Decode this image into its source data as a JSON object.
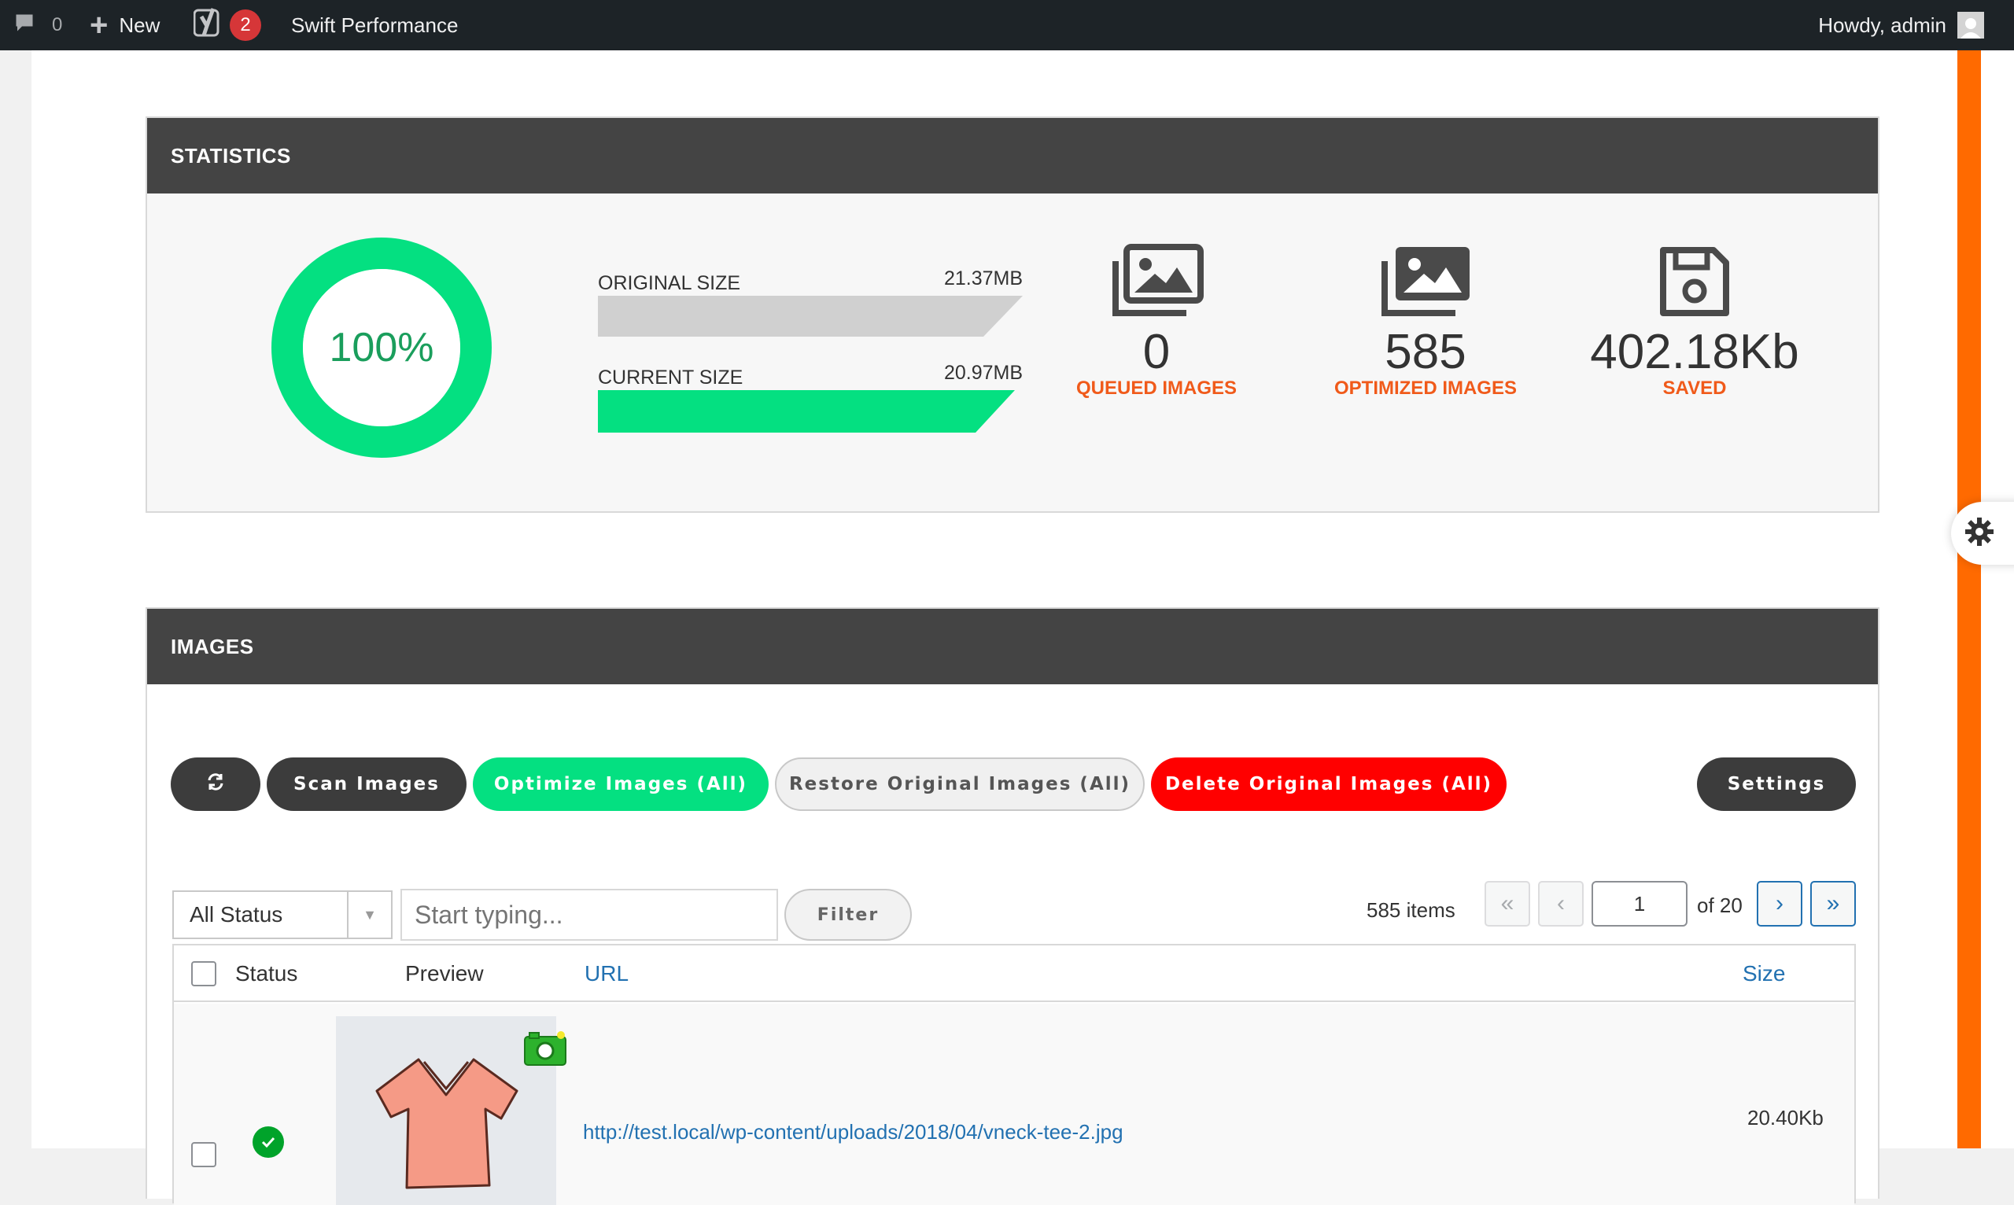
{
  "adminbar": {
    "comments_count": "0",
    "new_label": "New",
    "yoast_badge": "2",
    "site_name": "Swift Performance",
    "howdy": "Howdy, admin"
  },
  "statistics": {
    "title": "STATISTICS",
    "percent": "100%",
    "percent_value": 100,
    "original_size_label": "ORIGINAL SIZE",
    "original_size_value": "21.37MB",
    "current_size_label": "CURRENT SIZE",
    "current_size_value": "20.97MB",
    "queued_count": "0",
    "queued_label": "QUEUED IMAGES",
    "optimized_count": "585",
    "optimized_label": "OPTIMIZED IMAGES",
    "saved_value": "402.18Kb",
    "saved_label": "SAVED",
    "colors": {
      "accent_green": "#04e081",
      "label_orange": "#f05a1a",
      "bar_grey": "#d0d0d0"
    }
  },
  "images": {
    "title": "IMAGES",
    "buttons": {
      "scan": "Scan Images",
      "optimize_all": "Optimize Images (All)",
      "restore_all": "Restore Original Images (All)",
      "delete_all": "Delete Original Images (All)",
      "settings": "Settings"
    },
    "filter": {
      "status_selected": "All Status",
      "search_placeholder": "Start typing...",
      "filter_label": "Filter"
    },
    "pagination": {
      "items": "585 items",
      "first": "«",
      "prev": "‹",
      "current_page": "1",
      "of_total": "of 20",
      "next": "›",
      "last": "»"
    },
    "table": {
      "headers": {
        "status": "Status",
        "preview": "Preview",
        "url": "URL",
        "size": "Size"
      },
      "rows": [
        {
          "url": "http://test.local/wp-content/uploads/2018/04/vneck-tee-2.jpg",
          "size": "20.40Kb",
          "status": "optimized"
        }
      ]
    }
  }
}
